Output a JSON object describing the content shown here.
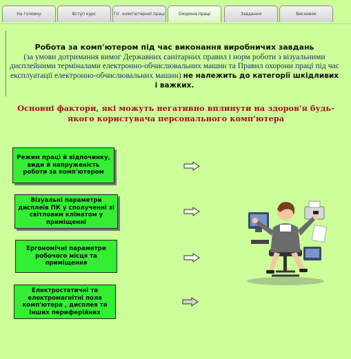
{
  "tabs": [
    {
      "label": "На головну"
    },
    {
      "label": "Вступ курс"
    },
    {
      "label": "Гіг. комп'ютерної праці"
    },
    {
      "label": "Охорона праці"
    },
    {
      "label": "Завдання"
    },
    {
      "label": "Висновок"
    }
  ],
  "intro": {
    "title": "Робота за комп'ютером під час виконання виробничих завдань",
    "body": "(за умови дотримання вимог Державних санітарних правил і норм роботи з візуальними дисплейними терміналами електронно-обчислювальних машин та Правил охорони праці під час експлуатації електронно-обчислювальних машин)",
    "emphasis": "не належить до категорії шкідливих і важких."
  },
  "heading": "Основні фактори, які можуть негативно вплинути на здоров'я будь-якого користувача персонального комп'ютера",
  "factors": [
    {
      "label": "Режим праці й відпочинку, види й напруженість роботи за комп'ютером"
    },
    {
      "label": "Візуальні параметри дисплеїв ПК у сполученні зі світловим кліматом у приміщенні"
    },
    {
      "label": "Ергономічні параметри робочого місця та приміщення"
    },
    {
      "label": "Електростатичні та електромагнітні поля комп'ютера , дисплея та інших периферійних"
    }
  ],
  "icons": {
    "arrow": "arrow-right-icon",
    "illustration": "office-woman-multitasking-illustration"
  },
  "colors": {
    "background": "#ccff99",
    "factor_box": "#33ee33",
    "heading": "#a01020"
  }
}
